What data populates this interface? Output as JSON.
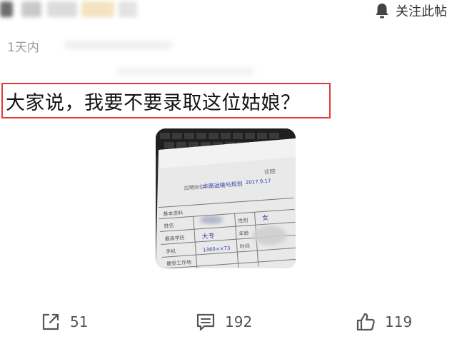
{
  "header": {
    "follow_label": "关注此帖",
    "bell_icon": "bell-icon"
  },
  "post": {
    "time": "1天内",
    "question": "大家说，我要不要录取这位姑娘？"
  },
  "photo": {
    "form_header_label": "基本资料",
    "row_labels": [
      "姓名",
      "最高学历",
      "手机",
      "最受工作地"
    ],
    "right_labels": [
      "性别",
      "年龄",
      "时间"
    ],
    "handwriting": [
      "本路运输与规划",
      "2017.9.17",
      "大专",
      "女"
    ]
  },
  "actions": {
    "share_count": "51",
    "comment_count": "192",
    "like_count": "119",
    "share_icon": "share-icon",
    "comment_icon": "comment-icon",
    "like_icon": "thumbs-up-icon"
  },
  "colors": {
    "highlight_border": "#e23a3a",
    "meta_text": "#9a9a9a",
    "action_text": "#555555"
  }
}
